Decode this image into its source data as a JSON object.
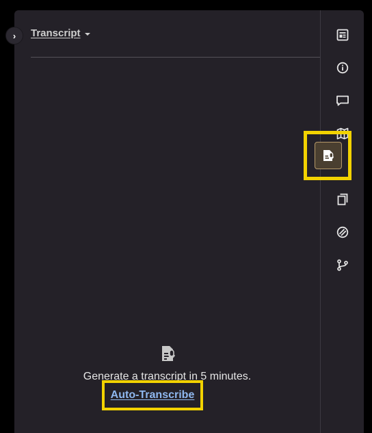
{
  "header": {
    "title": "Transcript"
  },
  "empty_state": {
    "message": "Generate a transcript in 5 minutes.",
    "action_label": "Auto-Transcribe"
  },
  "rail": {
    "items": [
      "article-icon",
      "info-icon",
      "comments-icon",
      "map-icon",
      "transcript-icon",
      "notes-icon",
      "block-icon",
      "branch-icon"
    ],
    "active": "transcript-icon"
  },
  "colors": {
    "panel_bg": "#242128",
    "highlight": "#f2d200",
    "link": "#8fb8f0",
    "active_bg": "#4a3f30"
  }
}
